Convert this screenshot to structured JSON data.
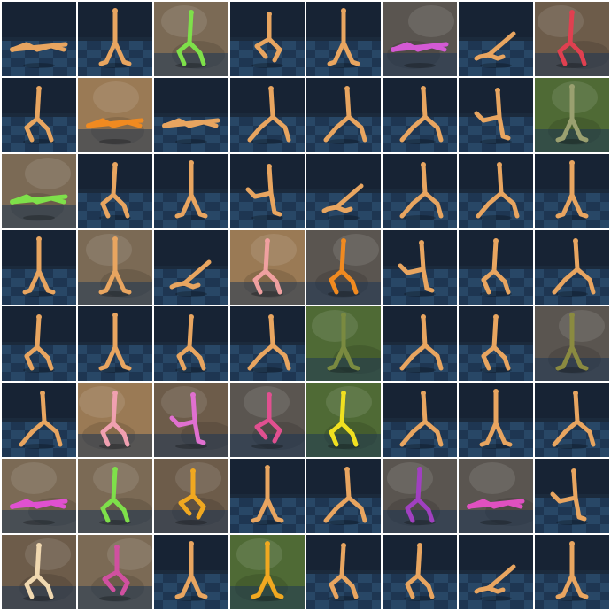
{
  "grid": {
    "rows": 8,
    "cols": 8
  },
  "background_colors": {
    "sim": "#1b2a3c",
    "sim_floor_a": "#2a4a6a",
    "sim_floor_b": "#1f3754",
    "photo_street": "#7b6a55",
    "photo_grass": "#4f6a35",
    "photo_dirt": "#9a7a55",
    "photo_indoor": "#6d5c4a",
    "photo_blur": "#5a5550"
  },
  "tiles": [
    {
      "bg": "sim",
      "color": "#e8a560",
      "pose": "lying"
    },
    {
      "bg": "sim",
      "color": "#e8a560",
      "pose": "stand"
    },
    {
      "bg": "photo_street",
      "color": "#7ee04a",
      "pose": "walk"
    },
    {
      "bg": "sim",
      "color": "#e8a560",
      "pose": "crouch"
    },
    {
      "bg": "sim",
      "color": "#e8a560",
      "pose": "stand"
    },
    {
      "bg": "photo_blur",
      "color": "#d45ad4",
      "pose": "lying"
    },
    {
      "bg": "sim",
      "color": "#e8a560",
      "pose": "sitting"
    },
    {
      "bg": "photo_indoor",
      "color": "#e04050",
      "pose": "walk"
    },
    {
      "bg": "sim",
      "color": "#e8a560",
      "pose": "walk"
    },
    {
      "bg": "photo_dirt",
      "color": "#f08a20",
      "pose": "lying"
    },
    {
      "bg": "sim",
      "color": "#e8a560",
      "pose": "lying"
    },
    {
      "bg": "sim",
      "color": "#e8a560",
      "pose": "lunge"
    },
    {
      "bg": "sim",
      "color": "#e8a560",
      "pose": "lunge"
    },
    {
      "bg": "sim",
      "color": "#e8a560",
      "pose": "lunge"
    },
    {
      "bg": "sim",
      "color": "#e8a560",
      "pose": "kick"
    },
    {
      "bg": "photo_grass",
      "color": "#9aa070",
      "pose": "stand"
    },
    {
      "bg": "photo_street",
      "color": "#7ee04a",
      "pose": "lying"
    },
    {
      "bg": "sim",
      "color": "#e8a560",
      "pose": "walk"
    },
    {
      "bg": "sim",
      "color": "#e8a560",
      "pose": "stand"
    },
    {
      "bg": "sim",
      "color": "#e8a560",
      "pose": "kick"
    },
    {
      "bg": "sim",
      "color": "#e8a560",
      "pose": "sitting"
    },
    {
      "bg": "sim",
      "color": "#e8a560",
      "pose": "lunge"
    },
    {
      "bg": "sim",
      "color": "#e8a560",
      "pose": "lunge"
    },
    {
      "bg": "sim",
      "color": "#e8a560",
      "pose": "stand"
    },
    {
      "bg": "sim",
      "color": "#e8a560",
      "pose": "stand"
    },
    {
      "bg": "photo_street",
      "color": "#e8a560",
      "pose": "stand"
    },
    {
      "bg": "sim",
      "color": "#e8a560",
      "pose": "sitting"
    },
    {
      "bg": "photo_dirt",
      "color": "#f0a0a0",
      "pose": "walk"
    },
    {
      "bg": "photo_blur",
      "color": "#f08a20",
      "pose": "walk"
    },
    {
      "bg": "sim",
      "color": "#e8a560",
      "pose": "kick"
    },
    {
      "bg": "sim",
      "color": "#e8a560",
      "pose": "walk"
    },
    {
      "bg": "sim",
      "color": "#e8a560",
      "pose": "lunge"
    },
    {
      "bg": "sim",
      "color": "#e8a560",
      "pose": "walk"
    },
    {
      "bg": "sim",
      "color": "#e8a560",
      "pose": "stand"
    },
    {
      "bg": "sim",
      "color": "#e8a560",
      "pose": "walk"
    },
    {
      "bg": "sim",
      "color": "#e8a560",
      "pose": "lunge"
    },
    {
      "bg": "photo_grass",
      "color": "#7a8a40",
      "pose": "stand"
    },
    {
      "bg": "sim",
      "color": "#e8a560",
      "pose": "lunge"
    },
    {
      "bg": "sim",
      "color": "#e8a560",
      "pose": "walk"
    },
    {
      "bg": "photo_blur",
      "color": "#8a8a40",
      "pose": "stand"
    },
    {
      "bg": "sim",
      "color": "#e8a560",
      "pose": "lunge"
    },
    {
      "bg": "photo_dirt",
      "color": "#f0a0b0",
      "pose": "walk"
    },
    {
      "bg": "photo_indoor",
      "color": "#e070d0",
      "pose": "kick"
    },
    {
      "bg": "photo_blur",
      "color": "#e05090",
      "pose": "crouch"
    },
    {
      "bg": "photo_grass",
      "color": "#f0e020",
      "pose": "walk"
    },
    {
      "bg": "sim",
      "color": "#e8a560",
      "pose": "lunge"
    },
    {
      "bg": "sim",
      "color": "#e8a560",
      "pose": "stand"
    },
    {
      "bg": "sim",
      "color": "#e8a560",
      "pose": "lunge"
    },
    {
      "bg": "photo_street",
      "color": "#e050d0",
      "pose": "lying"
    },
    {
      "bg": "photo_street",
      "color": "#7ee04a",
      "pose": "walk"
    },
    {
      "bg": "photo_indoor",
      "color": "#f0a820",
      "pose": "crouch"
    },
    {
      "bg": "sim",
      "color": "#e8a560",
      "pose": "stand"
    },
    {
      "bg": "sim",
      "color": "#e8a560",
      "pose": "lunge"
    },
    {
      "bg": "photo_blur",
      "color": "#a040c0",
      "pose": "walk"
    },
    {
      "bg": "photo_blur",
      "color": "#e050c0",
      "pose": "lying"
    },
    {
      "bg": "sim",
      "color": "#e8a560",
      "pose": "kick"
    },
    {
      "bg": "photo_indoor",
      "color": "#f0d8b0",
      "pose": "walk"
    },
    {
      "bg": "photo_street",
      "color": "#d050a0",
      "pose": "crouch"
    },
    {
      "bg": "sim",
      "color": "#e8a560",
      "pose": "stand"
    },
    {
      "bg": "photo_grass",
      "color": "#f0a820",
      "pose": "stand"
    },
    {
      "bg": "sim",
      "color": "#e8a560",
      "pose": "walk"
    },
    {
      "bg": "sim",
      "color": "#e8a560",
      "pose": "walk"
    },
    {
      "bg": "sim",
      "color": "#e8a560",
      "pose": "sitting"
    },
    {
      "bg": "sim",
      "color": "#e8a560",
      "pose": "stand"
    }
  ]
}
